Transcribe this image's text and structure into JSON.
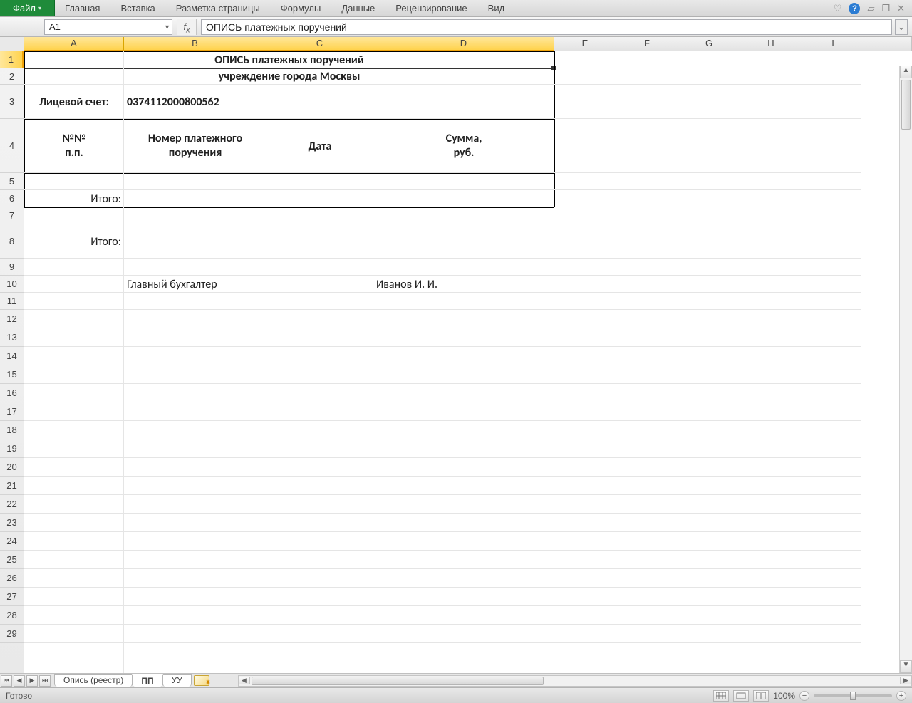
{
  "ribbon": {
    "file": "Файл",
    "tabs": [
      "Главная",
      "Вставка",
      "Разметка страницы",
      "Формулы",
      "Данные",
      "Рецензирование",
      "Вид"
    ]
  },
  "namebox": "A1",
  "formula": "ОПИСЬ платежных поручений",
  "columns": {
    "labels": [
      "A",
      "B",
      "C",
      "D",
      "E",
      "F",
      "G",
      "H",
      "I"
    ],
    "widths": [
      140,
      200,
      150,
      254,
      87,
      87,
      87,
      87,
      87
    ],
    "selected": [
      0,
      1,
      2,
      3
    ]
  },
  "rows": {
    "count": 29,
    "heights": {
      "1": 24,
      "2": 23,
      "3": 48,
      "4": 76,
      "5": 24,
      "6": 24,
      "7": 24,
      "8": 48,
      "9": 24,
      "10": 24,
      "11": 24,
      "12": 26,
      "13": 26,
      "14": 26,
      "15": 26,
      "16": 26,
      "17": 26,
      "18": 26,
      "19": 26,
      "20": 26,
      "21": 26,
      "22": 26,
      "23": 26,
      "24": 26,
      "25": 26,
      "26": 26,
      "27": 26,
      "28": 26,
      "29": 26
    },
    "selected": [
      1
    ]
  },
  "content": {
    "title": "ОПИСЬ платежных поручений",
    "subtitle": "учреждение города Москвы",
    "account_label": "Лицевой счет:",
    "account_value": "0374112000800562",
    "th1": "№№\nп.п.",
    "th2": "Номер платежного\nпоручения",
    "th3": "Дата",
    "th4": "Сумма,\nруб.",
    "itogo": "Итого:",
    "itogo2": "Итого:",
    "accountant_label": "Главный бухгалтер",
    "accountant_name": "Иванов И. И."
  },
  "sheets": {
    "tabs": [
      "Опись (реестр)",
      "ПП",
      "УУ"
    ],
    "active": 1
  },
  "status": {
    "ready": "Готово",
    "zoom": "100%"
  }
}
